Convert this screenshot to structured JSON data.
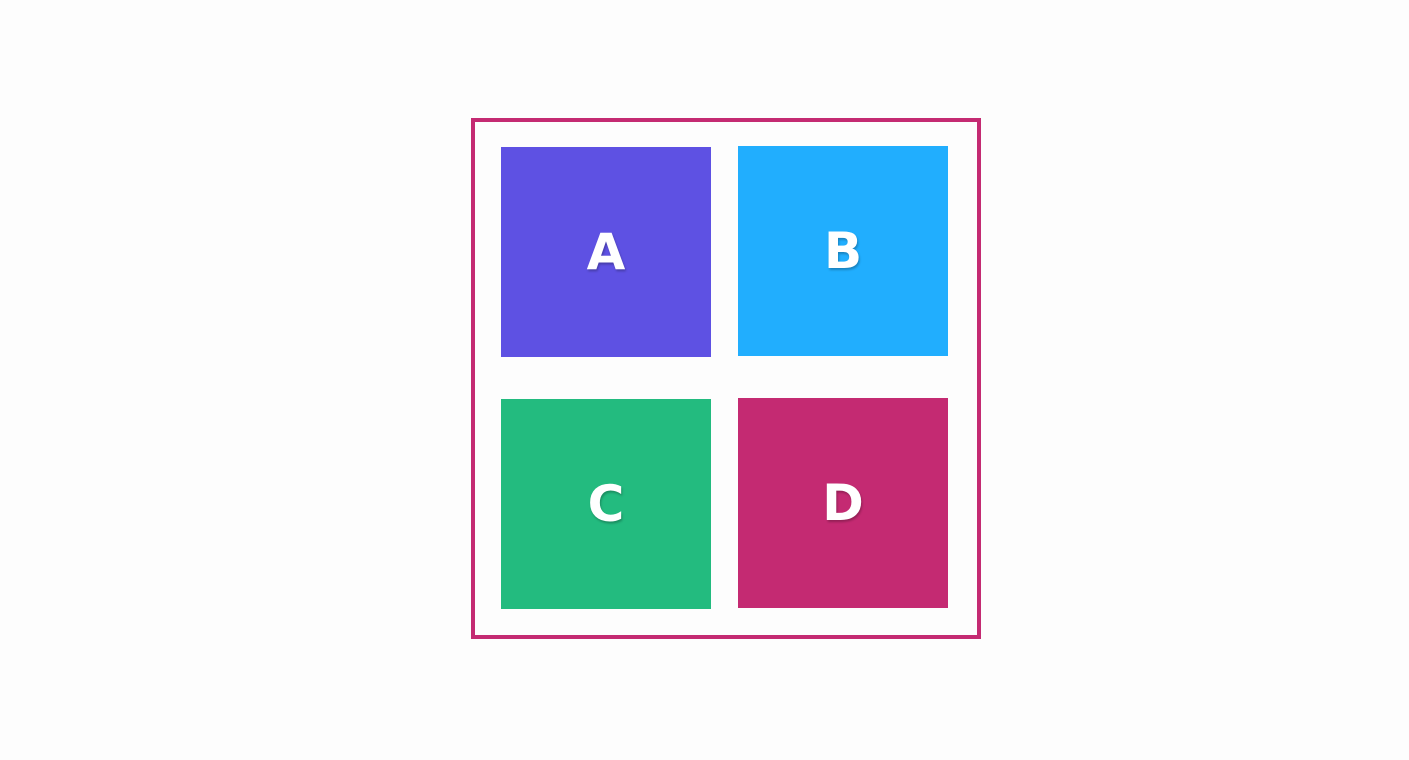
{
  "grid": {
    "border_color": "#c42a72",
    "tiles": [
      {
        "label": "A",
        "color": "#5e51e3"
      },
      {
        "label": "B",
        "color": "#21aefe"
      },
      {
        "label": "C",
        "color": "#23bb7f"
      },
      {
        "label": "D",
        "color": "#c42a72"
      }
    ]
  }
}
